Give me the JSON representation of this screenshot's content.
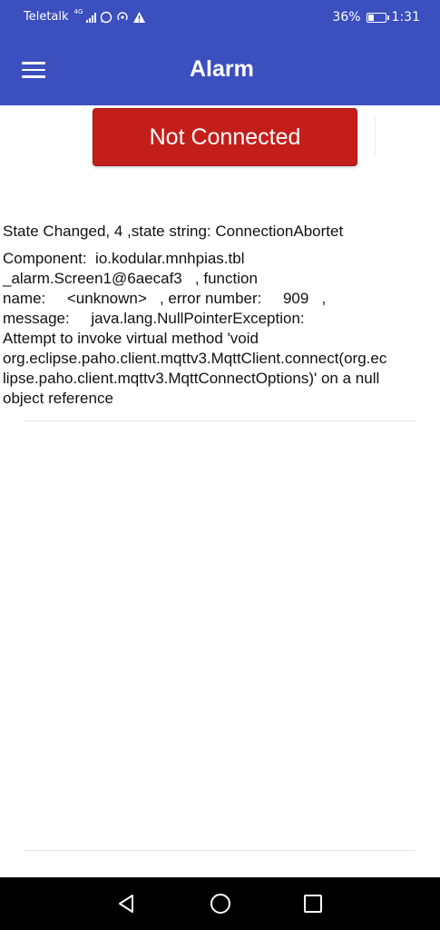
{
  "status_bar": {
    "carrier": "Teletalk",
    "network_type": "4G",
    "battery_percent": "36%",
    "battery_level": 0.36,
    "time": "1:31"
  },
  "app_bar": {
    "title": "Alarm"
  },
  "connect_button": {
    "label": "Not Connected",
    "color": "#c41e1a"
  },
  "state_message": "State Changed,  4   ,state string:  ConnectionAbortet",
  "error_message": "Component:  io.kodular.mnhpias.tbl\n_alarm.Screen1@6aecaf3   , function\nname:     <unknown>   , error number:     909   ,\nmessage:     java.lang.NullPointerException:\nAttempt to invoke virtual method 'void\norg.eclipse.paho.client.mqttv3.MqttClient.connect(org.ec\nlipse.paho.client.mqttv3.MqttConnectOptions)' on a null\nobject reference",
  "colors": {
    "primary": "#3b4fbf",
    "error_button": "#c41e1a",
    "nav_bar": "#000000"
  },
  "icons": {
    "menu": "hamburger-menu-icon",
    "back": "back-triangle-icon",
    "home": "home-circle-icon",
    "recent": "recent-apps-square-icon"
  }
}
